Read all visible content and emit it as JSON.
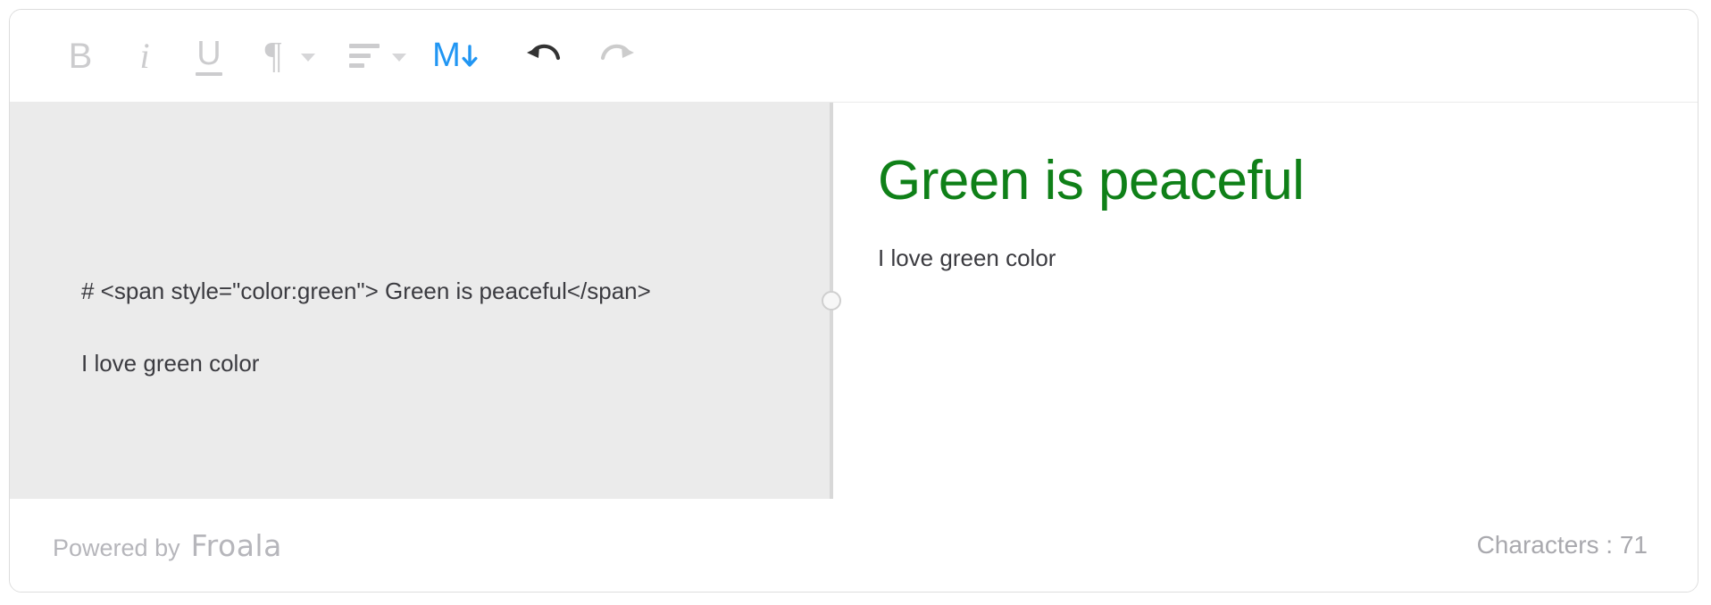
{
  "toolbar": {
    "buttons": [
      {
        "name": "bold-icon",
        "label": "B",
        "state": "inactive"
      },
      {
        "name": "italic-icon",
        "label": "i",
        "state": "inactive"
      },
      {
        "name": "underline-icon",
        "label": "U",
        "state": "inactive"
      },
      {
        "name": "paragraph-format-icon",
        "label": "¶",
        "state": "inactive"
      },
      {
        "name": "align-left-icon",
        "label": "align",
        "state": "inactive"
      },
      {
        "name": "markdown-icon",
        "label": "M",
        "state": "active"
      },
      {
        "name": "undo-icon",
        "label": "undo",
        "state": "enabled"
      },
      {
        "name": "redo-icon",
        "label": "redo",
        "state": "disabled"
      }
    ],
    "colors": {
      "inactive": "#ccccce",
      "markdown_active": "#2196f3",
      "undo_enabled": "#333333",
      "redo_disabled": "#cccccc"
    }
  },
  "editor": {
    "source": {
      "line1": "# <span style=\"color:green\"> Green is peaceful</span>",
      "line2": "I love green color"
    },
    "preview": {
      "heading": "Green is peaceful",
      "heading_color": "#0f8018",
      "paragraph": "I love green color"
    }
  },
  "footer": {
    "powered_label": "Powered by",
    "brand": "Froala",
    "character_count": "Characters : 71"
  }
}
